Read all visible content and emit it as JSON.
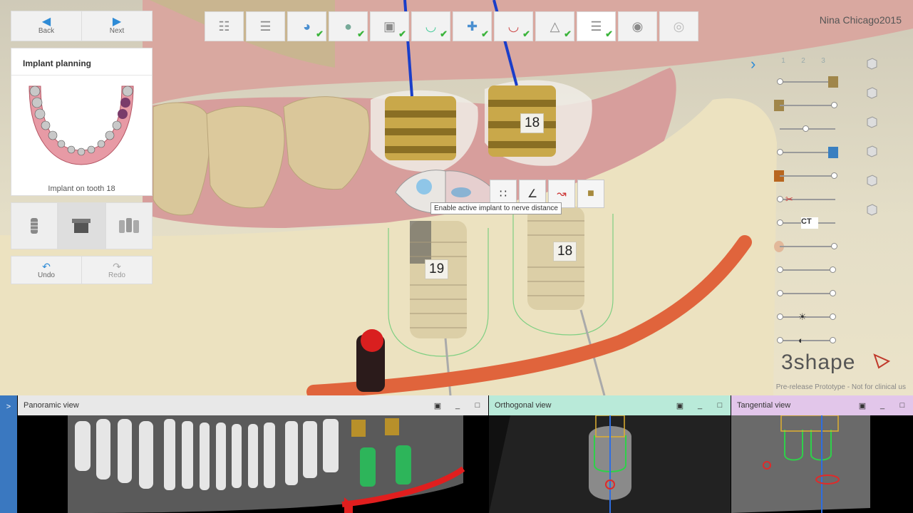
{
  "nav": {
    "back_label": "Back",
    "next_label": "Next"
  },
  "workflow": {
    "steps": [
      {
        "icon": "patient-info-icon",
        "done": false
      },
      {
        "icon": "order-form-icon",
        "done": false
      },
      {
        "icon": "scan-import-icon",
        "done": true
      },
      {
        "icon": "align-icon",
        "done": true
      },
      {
        "icon": "ct-volume-icon",
        "done": true
      },
      {
        "icon": "panoramic-curve-icon",
        "done": true
      },
      {
        "icon": "nerve-icon",
        "done": true
      },
      {
        "icon": "soft-tissue-icon",
        "done": true
      },
      {
        "icon": "crown-icon",
        "done": true
      },
      {
        "icon": "implant-icon",
        "done": true,
        "active": true
      },
      {
        "icon": "sleeve-icon",
        "done": false
      },
      {
        "icon": "disc-icon",
        "done": false
      }
    ]
  },
  "user": {
    "name": "Nina Chicago2015"
  },
  "implant_panel": {
    "title": "Implant planning",
    "caption": "Implant on tooth 18"
  },
  "undo": {
    "undo_label": "Undo",
    "redo_label": "Redo"
  },
  "implants": {
    "front": "19",
    "back": "18",
    "back_lower": "18"
  },
  "tooltip": {
    "text": "Enable active implant to nerve distance"
  },
  "right_panel": {
    "tabs": [
      "1",
      "2",
      "3"
    ],
    "slider_labels": {
      "ct": "CT"
    }
  },
  "brand": {
    "logo_text": "3shape",
    "disclaimer": "Pre-release Prototype - Not for clinical us"
  },
  "panes": {
    "panoramic": {
      "title": "Panoramic view",
      "color": "#e8e8e8"
    },
    "orthogonal": {
      "title": "Orthogonal view",
      "color": "#b9ead9"
    },
    "tangential": {
      "title": "Tangential view",
      "color": "#e2c6ea"
    }
  },
  "colors": {
    "accent": "#2e8bd6",
    "check": "#3cb43c",
    "nerve": "#e0643c"
  }
}
